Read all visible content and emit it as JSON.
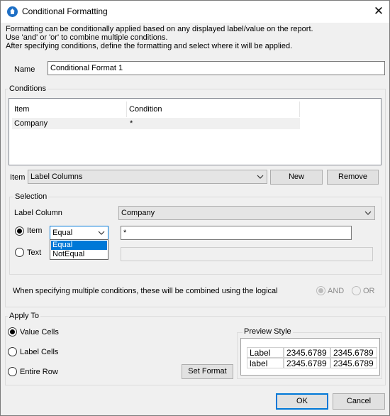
{
  "window": {
    "title": "Conditional Formatting",
    "close_label": "✕"
  },
  "description": [
    "Formatting can be conditionally applied based on any displayed label/value on the report.",
    "Use 'and' or 'or' to combine multiple conditions.",
    "After specifying conditions, define the formatting and select where it will be applied."
  ],
  "name": {
    "label": "Name",
    "value": "Conditional Format 1"
  },
  "conditions": {
    "group_label": "Conditions",
    "columns": [
      "Item",
      "Condition"
    ],
    "rows": [
      {
        "item": "Company",
        "condition": "*"
      }
    ]
  },
  "item_row": {
    "label": "Item",
    "selected": "Label Columns",
    "new_label": "New",
    "remove_label": "Remove"
  },
  "selection": {
    "group_label": "Selection",
    "label_column_label": "Label Column",
    "label_column_value": "Company",
    "item_radio_label": "Item",
    "operator_value": "Equal",
    "operator_options": [
      "Equal",
      "NotEqual"
    ],
    "item_value": "*",
    "text_radio_label": "Text",
    "text_value": ""
  },
  "logical": {
    "text": "When specifying multiple conditions, these will be combined using the logical",
    "and_label": "AND",
    "or_label": "OR"
  },
  "apply_to": {
    "group_label": "Apply To",
    "value_cells": "Value Cells",
    "label_cells": "Label Cells",
    "entire_row": "Entire Row",
    "set_format_label": "Set Format"
  },
  "preview": {
    "group_label": "Preview Style",
    "rows": [
      [
        "Label",
        "2345.6789",
        "2345.6789"
      ],
      [
        "label",
        "2345.6789",
        "2345.6789"
      ]
    ]
  },
  "footer": {
    "ok_label": "OK",
    "cancel_label": "Cancel"
  },
  "colors": {
    "accent": "#0078d7",
    "title_icon": "#1e6fc5"
  }
}
